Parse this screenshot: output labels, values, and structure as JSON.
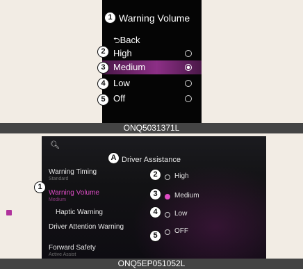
{
  "panel1": {
    "title": "Warning Volume",
    "back_label": "Back",
    "options": [
      {
        "label": "High",
        "selected": false
      },
      {
        "label": "Medium",
        "selected": true
      },
      {
        "label": "Low",
        "selected": false
      },
      {
        "label": "Off",
        "selected": false
      }
    ],
    "callouts": [
      "1",
      "2",
      "3",
      "4",
      "5"
    ],
    "caption": "ONQ5031371L"
  },
  "panel2": {
    "title": "Driver Assistance",
    "title_callout": "A",
    "menu_items": [
      {
        "label": "Warning Timing",
        "sub": "Standard"
      },
      {
        "label": "Warning Volume",
        "sub": "Medium"
      },
      {
        "label": "Haptic Warning",
        "checked": true
      },
      {
        "label": "Driver Attention Warning"
      },
      {
        "label": "Forward Safety",
        "sub": "Active Assist"
      }
    ],
    "options": [
      {
        "label": "High",
        "selected": false
      },
      {
        "label": "Medium",
        "selected": true
      },
      {
        "label": "Low",
        "selected": false
      },
      {
        "label": "OFF",
        "selected": false
      }
    ],
    "callouts": [
      "1",
      "2",
      "3",
      "4",
      "5"
    ],
    "caption": "ONQ5EP051052L"
  },
  "colors": {
    "accent": "#b0329c",
    "caption_bar": "#444444",
    "page_background": "#f2ece4"
  }
}
